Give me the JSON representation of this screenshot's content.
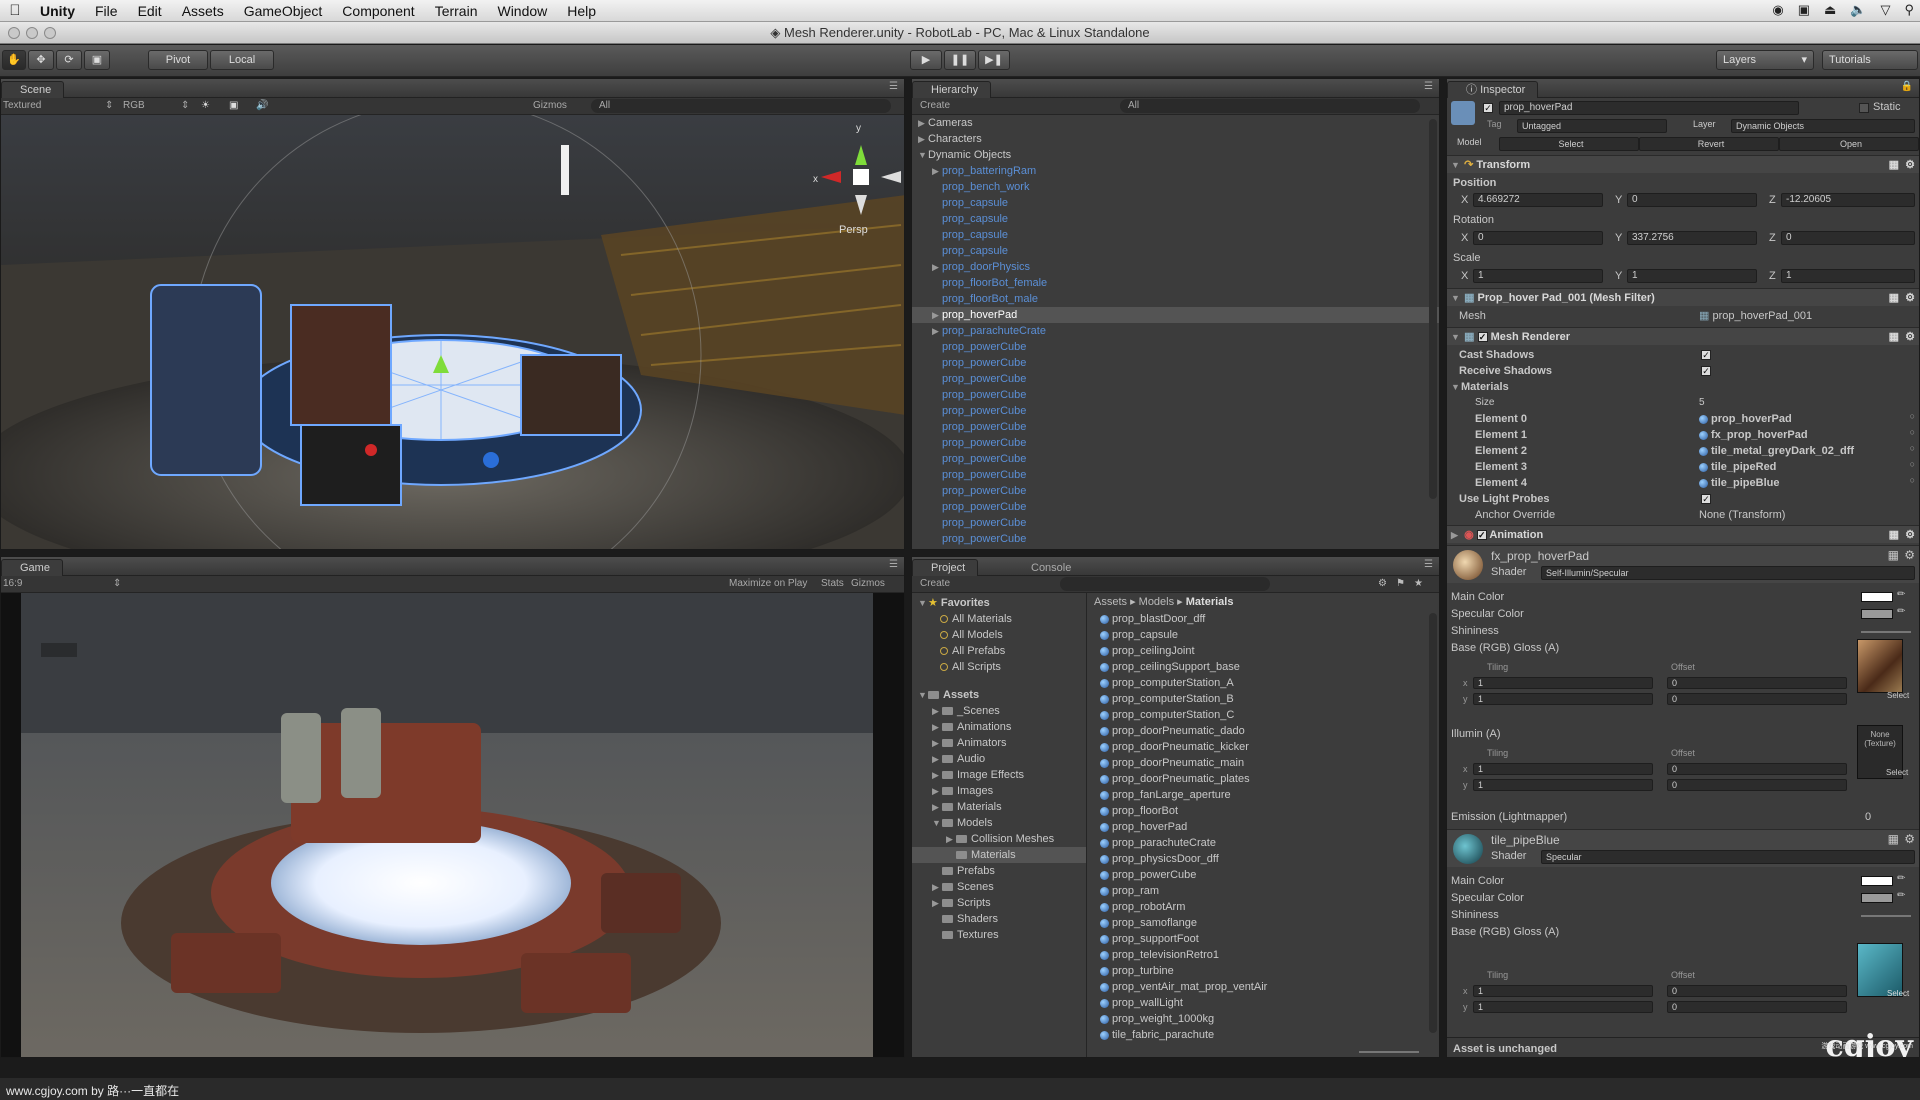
{
  "menubar": {
    "app": "Unity",
    "items": [
      "File",
      "Edit",
      "Assets",
      "GameObject",
      "Component",
      "Terrain",
      "Window",
      "Help"
    ]
  },
  "window": {
    "title": "Mesh Renderer.unity - RobotLab - PC, Mac & Linux Standalone"
  },
  "toolbar": {
    "pivot": "Pivot",
    "local": "Local",
    "layers": "Layers",
    "layout": "Tutorials"
  },
  "scene": {
    "tab": "Scene",
    "shading": "Textured",
    "render_mode": "RGB",
    "gizmos": "Gizmos",
    "search": "All",
    "persp": "Persp",
    "gizmo_x": "x",
    "gizmo_y": "y"
  },
  "game": {
    "tab": "Game",
    "aspect": "16:9",
    "maximize": "Maximize on Play",
    "stats": "Stats",
    "gizmos": "Gizmos"
  },
  "hierarchy": {
    "tab": "Hierarchy",
    "create": "Create",
    "search": "All",
    "items": [
      {
        "label": "Cameras",
        "level": 0,
        "arrow": "▶",
        "blue": false
      },
      {
        "label": "Characters",
        "level": 0,
        "arrow": "▶",
        "blue": false
      },
      {
        "label": "Dynamic Objects",
        "level": 0,
        "arrow": "▼",
        "blue": false
      },
      {
        "label": "prop_batteringRam",
        "level": 1,
        "arrow": "▶",
        "blue": true
      },
      {
        "label": "prop_bench_work",
        "level": 1,
        "arrow": "",
        "blue": true
      },
      {
        "label": "prop_capsule",
        "level": 1,
        "arrow": "",
        "blue": true
      },
      {
        "label": "prop_capsule",
        "level": 1,
        "arrow": "",
        "blue": true
      },
      {
        "label": "prop_capsule",
        "level": 1,
        "arrow": "",
        "blue": true
      },
      {
        "label": "prop_capsule",
        "level": 1,
        "arrow": "",
        "blue": true
      },
      {
        "label": "prop_doorPhysics",
        "level": 1,
        "arrow": "▶",
        "blue": true
      },
      {
        "label": "prop_floorBot_female",
        "level": 1,
        "arrow": "",
        "blue": true
      },
      {
        "label": "prop_floorBot_male",
        "level": 1,
        "arrow": "",
        "blue": true
      },
      {
        "label": "prop_hoverPad",
        "level": 1,
        "arrow": "▶",
        "blue": false,
        "selected": true
      },
      {
        "label": "prop_parachuteCrate",
        "level": 1,
        "arrow": "▶",
        "blue": true
      },
      {
        "label": "prop_powerCube",
        "level": 1,
        "arrow": "",
        "blue": true
      },
      {
        "label": "prop_powerCube",
        "level": 1,
        "arrow": "",
        "blue": true
      },
      {
        "label": "prop_powerCube",
        "level": 1,
        "arrow": "",
        "blue": true
      },
      {
        "label": "prop_powerCube",
        "level": 1,
        "arrow": "",
        "blue": true
      },
      {
        "label": "prop_powerCube",
        "level": 1,
        "arrow": "",
        "blue": true
      },
      {
        "label": "prop_powerCube",
        "level": 1,
        "arrow": "",
        "blue": true
      },
      {
        "label": "prop_powerCube",
        "level": 1,
        "arrow": "",
        "blue": true
      },
      {
        "label": "prop_powerCube",
        "level": 1,
        "arrow": "",
        "blue": true
      },
      {
        "label": "prop_powerCube",
        "level": 1,
        "arrow": "",
        "blue": true
      },
      {
        "label": "prop_powerCube",
        "level": 1,
        "arrow": "",
        "blue": true
      },
      {
        "label": "prop_powerCube",
        "level": 1,
        "arrow": "",
        "blue": true
      },
      {
        "label": "prop_powerCube",
        "level": 1,
        "arrow": "",
        "blue": true
      },
      {
        "label": "prop_powerCube",
        "level": 1,
        "arrow": "",
        "blue": true
      }
    ]
  },
  "project": {
    "tab": "Project",
    "console_tab": "Console",
    "create": "Create",
    "breadcrumb": [
      "Assets",
      "Models",
      "Materials"
    ],
    "favorites_label": "Favorites",
    "favorites": [
      "All Materials",
      "All Models",
      "All Prefabs",
      "All Scripts"
    ],
    "assets_label": "Assets",
    "folders": [
      {
        "label": "_Scenes",
        "level": 1,
        "arrow": "▶"
      },
      {
        "label": "Animations",
        "level": 1,
        "arrow": "▶"
      },
      {
        "label": "Animators",
        "level": 1,
        "arrow": "▶"
      },
      {
        "label": "Audio",
        "level": 1,
        "arrow": "▶"
      },
      {
        "label": "Image Effects",
        "level": 1,
        "arrow": "▶"
      },
      {
        "label": "Images",
        "level": 1,
        "arrow": "▶"
      },
      {
        "label": "Materials",
        "level": 1,
        "arrow": "▶"
      },
      {
        "label": "Models",
        "level": 1,
        "arrow": "▼"
      },
      {
        "label": "Collision Meshes",
        "level": 2,
        "arrow": "▶"
      },
      {
        "label": "Materials",
        "level": 2,
        "arrow": "",
        "selected": true
      },
      {
        "label": "Prefabs",
        "level": 1,
        "arrow": ""
      },
      {
        "label": "Scenes",
        "level": 1,
        "arrow": "▶"
      },
      {
        "label": "Scripts",
        "level": 1,
        "arrow": "▶"
      },
      {
        "label": "Shaders",
        "level": 1,
        "arrow": ""
      },
      {
        "label": "Textures",
        "level": 1,
        "arrow": ""
      }
    ],
    "files": [
      "prop_blastDoor_dff",
      "prop_capsule",
      "prop_ceilingJoint",
      "prop_ceilingSupport_base",
      "prop_computerStation_A",
      "prop_computerStation_B",
      "prop_computerStation_C",
      "prop_doorPneumatic_dado",
      "prop_doorPneumatic_kicker",
      "prop_doorPneumatic_main",
      "prop_doorPneumatic_plates",
      "prop_fanLarge_aperture",
      "prop_floorBot",
      "prop_hoverPad",
      "prop_parachuteCrate",
      "prop_physicsDoor_dff",
      "prop_powerCube",
      "prop_ram",
      "prop_robotArm",
      "prop_samoflange",
      "prop_supportFoot",
      "prop_televisionRetro1",
      "prop_turbine",
      "prop_ventAir_mat_prop_ventAir",
      "prop_wallLight",
      "prop_weight_1000kg",
      "tile_fabric_parachute"
    ]
  },
  "inspector": {
    "tab": "Inspector",
    "object_name": "prop_hoverPad",
    "static": "Static",
    "tag_label": "Tag",
    "tag_value": "Untagged",
    "layer_label": "Layer",
    "layer_value": "Dynamic Objects",
    "model_label": "Model",
    "model_select": "Select",
    "model_revert": "Revert",
    "model_open": "Open",
    "transform": {
      "title": "Transform",
      "position_label": "Position",
      "rotation_label": "Rotation",
      "scale_label": "Scale",
      "position": {
        "x": "4.669272",
        "y": "0",
        "z": "-12.20605"
      },
      "rotation": {
        "x": "0",
        "y": "337.2756",
        "z": "0"
      },
      "scale": {
        "x": "1",
        "y": "1",
        "z": "1"
      }
    },
    "mesh_filter": {
      "title": "Prop_hover Pad_001 (Mesh Filter)",
      "mesh_label": "Mesh",
      "mesh_value": "prop_hoverPad_001"
    },
    "mesh_renderer": {
      "title": "Mesh Renderer",
      "cast_shadows": "Cast Shadows",
      "receive_shadows": "Receive Shadows",
      "materials": "Materials",
      "size_label": "Size",
      "size_value": "5",
      "elements": [
        {
          "label": "Element 0",
          "value": "prop_hoverPad"
        },
        {
          "label": "Element 1",
          "value": "fx_prop_hoverPad"
        },
        {
          "label": "Element 2",
          "value": "tile_metal_greyDark_02_dff"
        },
        {
          "label": "Element 3",
          "value": "tile_pipeRed"
        },
        {
          "label": "Element 4",
          "value": "tile_pipeBlue"
        }
      ],
      "use_light_probes": "Use Light Probes",
      "anchor_override": "Anchor Override",
      "anchor_value": "None (Transform)"
    },
    "animation": {
      "title": "Animation"
    },
    "material1": {
      "name": "fx_prop_hoverPad",
      "shader_label": "Shader",
      "shader_value": "Self-Illumin/Specular",
      "main_color": "Main Color",
      "specular_color": "Specular Color",
      "shininess": "Shininess",
      "base": "Base (RGB) Gloss (A)",
      "tiling": "Tiling",
      "offset": "Offset",
      "tx": "1",
      "ty": "1",
      "ox": "0",
      "oy": "0",
      "select": "Select",
      "illum": "Illumin (A)",
      "illum_tex": "None (Texture)",
      "illum_tiling": "Tiling",
      "illum_offset": "Offset",
      "itx": "1",
      "ity": "1",
      "iox": "0",
      "ioy": "0",
      "emission": "Emission (Lightmapper)",
      "emission_value": "0"
    },
    "material2": {
      "name": "tile_pipeBlue",
      "shader_label": "Shader",
      "shader_value": "Specular",
      "main_color": "Main Color",
      "specular_color": "Specular Color",
      "shininess": "Shininess",
      "base": "Base (RGB) Gloss (A)",
      "tiling": "Tiling",
      "offset": "Offset",
      "tx": "1",
      "ty": "1",
      "ox": "0",
      "oy": "0",
      "select": "Select"
    },
    "status": "Asset is unchanged"
  },
  "watermark": {
    "left": "www.cgjoy.com by 路···一直都在",
    "brand": "cgjoy",
    "brand_sub": "游戏动画游戏 www.cgjoy.com"
  },
  "colors": {
    "panel_bg": "#3c3c3c",
    "link_blue": "#5b8fd6",
    "selection": "#545454"
  }
}
